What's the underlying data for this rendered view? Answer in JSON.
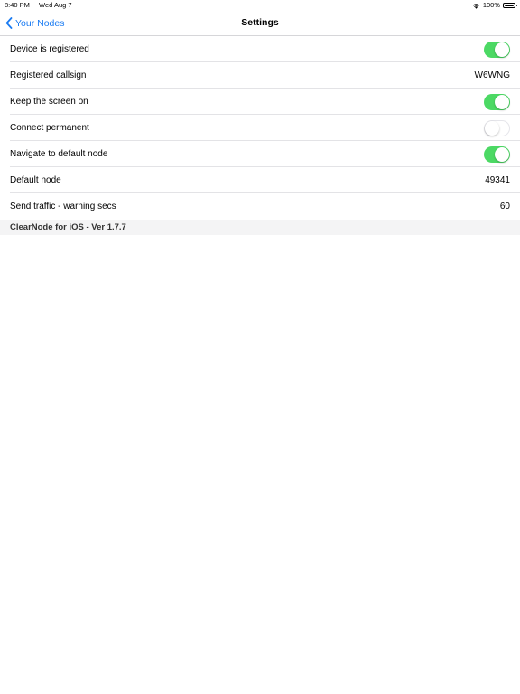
{
  "status_bar": {
    "time": "8:40 PM",
    "date": "Wed Aug 7",
    "battery": "100%",
    "wifi_icon": "wifi-icon",
    "battery_icon": "battery-icon"
  },
  "nav": {
    "back_label": "Your Nodes",
    "title": "Settings",
    "accent_color": "#1a7bf2"
  },
  "settings": [
    {
      "label": "Device is registered",
      "type": "toggle",
      "on": true
    },
    {
      "label": "Registered callsign",
      "type": "value",
      "value": "W6WNG"
    },
    {
      "label": "Keep the screen on",
      "type": "toggle",
      "on": true
    },
    {
      "label": "Connect permanent",
      "type": "toggle",
      "on": false
    },
    {
      "label": "Navigate to default node",
      "type": "toggle",
      "on": true
    },
    {
      "label": "Default node",
      "type": "value",
      "value": "49341"
    },
    {
      "label": "Send traffic - warning secs",
      "type": "value",
      "value": "60"
    }
  ],
  "toggle_on_color": "#4cd964",
  "footer": {
    "version_text": "ClearNode for iOS - Ver 1.7.7"
  }
}
